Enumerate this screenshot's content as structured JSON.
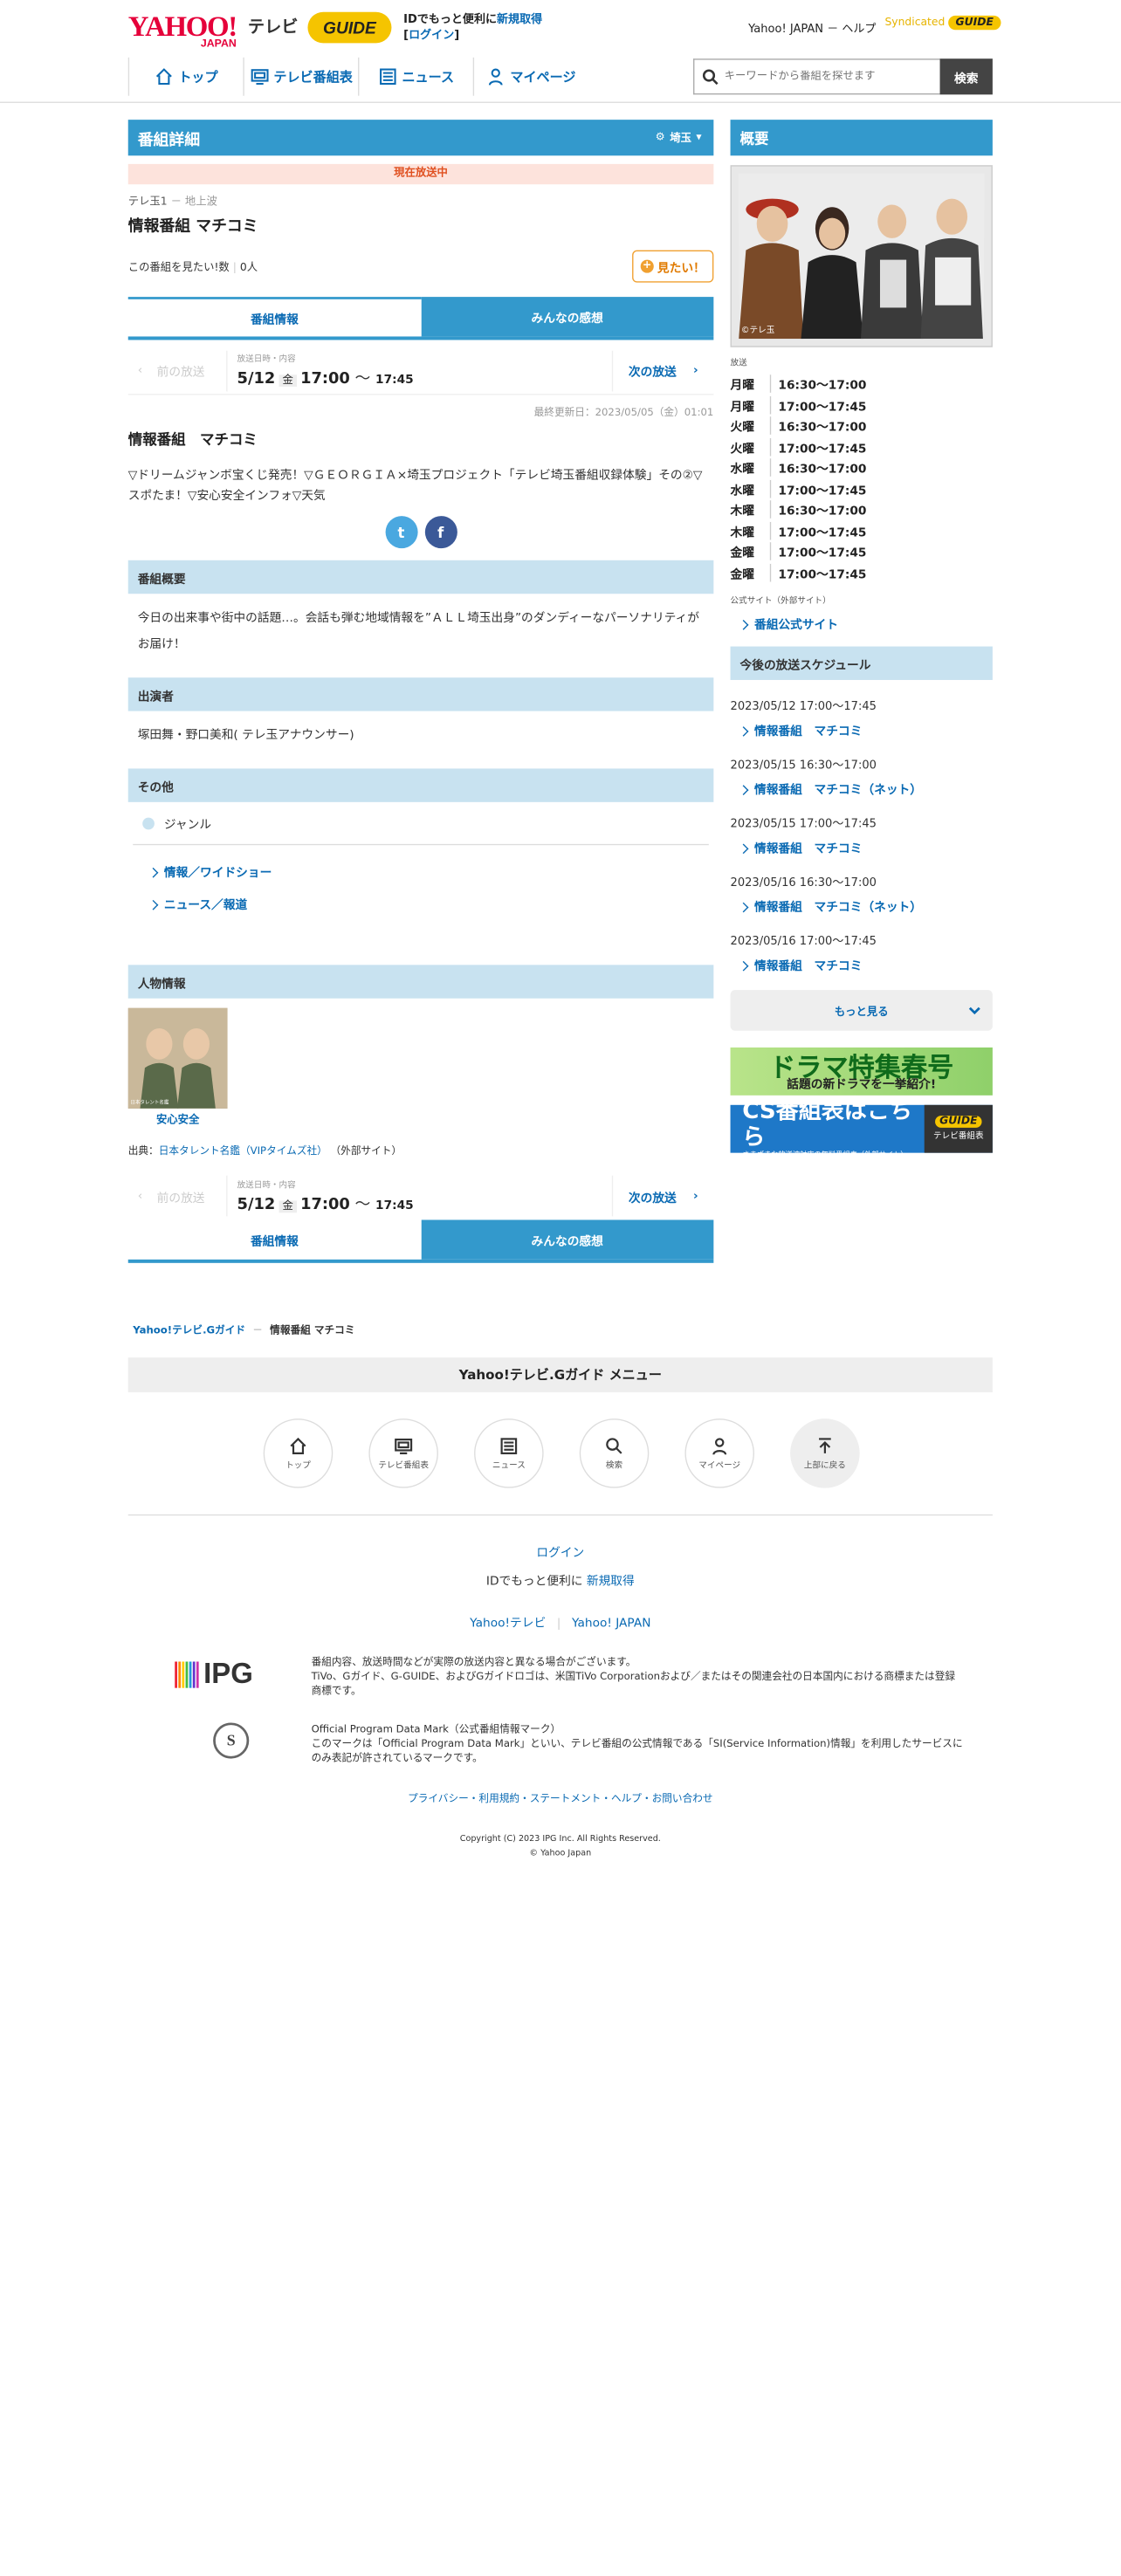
{
  "header": {
    "yahoo_logo": "YAHOO!",
    "yahoo_japan": "JAPAN",
    "tv_label": "テレビ",
    "gguide_logo": "GUIDE",
    "login_line1": "IDでもっと便利に",
    "signup": "新規取得",
    "login": "ログイン",
    "yahoo_japan_link": "Yahoo! JAPAN",
    "help": "ヘルプ",
    "syndicated": "Syndicated",
    "syndicated_badge": "GUIDE"
  },
  "nav": [
    {
      "label": "トップ",
      "icon": "home-icon"
    },
    {
      "label": "テレビ番組表",
      "icon": "tv-icon"
    },
    {
      "label": "ニュース",
      "icon": "news-icon"
    },
    {
      "label": "マイページ",
      "icon": "user-icon"
    }
  ],
  "search": {
    "placeholder": "キーワードから番組を探せます",
    "button": "検索"
  },
  "detail": {
    "bar_title": "番組詳細",
    "prefecture": "埼玉",
    "on_air": "現在放送中",
    "channel": "テレ玉1",
    "channel_type": "地上波",
    "title": "情報番組 マチコミ",
    "want_label": "この番組を見たい!数",
    "want_count": "0人",
    "want_button": "見たい！"
  },
  "tabs": {
    "info": "番組情報",
    "reviews": "みんなの感想"
  },
  "broadcast": {
    "prev": "前の放送",
    "label": "放送日時・内容",
    "date": "5/12",
    "weekday": "金",
    "start": "17:00",
    "sep": "〜",
    "end": "17:45",
    "next": "次の放送"
  },
  "updated": "最終更新日：2023/05/05（金）01:01",
  "program": {
    "title": "情報番組　マチコミ",
    "description": "▽ドリームジャンボ宝くじ発売！▽ＧＥＯＲＧＩＡ×埼玉プロジェクト「テレビ埼玉番組収録体験」その②▽スポたま！▽安心安全インフォ▽天気"
  },
  "sections": {
    "overview_title": "番組概要",
    "overview": "今日の出来事や街中の話題…。会話も弾む地域情報を”ＡＬＬ埼玉出身”のダンディーなパーソナリティがお届け！",
    "cast_title": "出演者",
    "cast": "塚田舞・野口美和( テレ玉アナウンサー)",
    "other_title": "その他",
    "genre_label": "ジャンル",
    "genres": [
      "情報／ワイドショー",
      "ニュース／報道"
    ],
    "people_title": "人物情報",
    "person_name": "安心安全",
    "person_credit": "日本タレント名鑑",
    "source_label": "出典：",
    "source_link": "日本タレント名鑑（VIPタイムズ社）",
    "source_note": "（外部サイト）"
  },
  "breadcrumb": {
    "home": "Yahoo!テレビ.Gガイド",
    "current": "情報番組 マチコミ"
  },
  "footer": {
    "menu_title": "Yahoo!テレビ.Gガイド メニュー",
    "icons": [
      "トップ",
      "テレビ番組表",
      "ニュース",
      "検索",
      "マイページ",
      "上部に戻る"
    ],
    "login": "ログイン",
    "id_text": "IDでもっと便利に",
    "signup": "新規取得",
    "yahoo_tv": "Yahoo!テレビ",
    "yahoo_japan": "Yahoo! JAPAN",
    "ipg": "IPG",
    "notice1": "番組内容、放送時間などが実際の放送内容と異なる場合がございます。",
    "notice2": "TiVo、Gガイド、G-GUIDE、およびGガイドロゴは、米国TiVo Corporationおよび／またはその関連会社の日本国内における商標または登録商標です。",
    "opdm_title": "Official Program Data Mark（公式番組情報マーク）",
    "opdm_text": "このマークは「Official Program Data Mark」といい、テレビ番組の公式情報である「SI(Service Information)情報」を利用したサービスにのみ表記が許されているマークです。",
    "seal": "S",
    "links": "プライバシー・利用規約・ステートメント・ヘルプ・お問い合わせ",
    "copyright": "Copyright (C) 2023 IPG Inc. All Rights Reserved.",
    "yahoo_copy": "© Yahoo Japan"
  },
  "side": {
    "overview_title": "概要",
    "image_credit": "©テレ玉",
    "broadcast_label": "放送",
    "schedule": [
      {
        "day": "月曜",
        "time": "16:30～17:00"
      },
      {
        "day": "月曜",
        "time": "17:00～17:45"
      },
      {
        "day": "火曜",
        "time": "16:30～17:00"
      },
      {
        "day": "火曜",
        "time": "17:00～17:45"
      },
      {
        "day": "水曜",
        "time": "16:30～17:00"
      },
      {
        "day": "水曜",
        "time": "17:00～17:45"
      },
      {
        "day": "木曜",
        "time": "16:30～17:00"
      },
      {
        "day": "木曜",
        "time": "17:00～17:45"
      },
      {
        "day": "金曜",
        "time": "17:00～17:45"
      },
      {
        "day": "金曜",
        "time": "17:00～17:45"
      }
    ],
    "official_label": "公式サイト（外部サイト）",
    "official_link": "番組公式サイト",
    "upcoming_title": "今後の放送スケジュール",
    "upcoming": [
      {
        "time": "2023/05/12 17:00～17:45",
        "title": "情報番組　マチコミ"
      },
      {
        "time": "2023/05/15 16:30～17:00",
        "title": "情報番組　マチコミ（ネット）"
      },
      {
        "time": "2023/05/15 17:00～17:45",
        "title": "情報番組　マチコミ"
      },
      {
        "time": "2023/05/16 16:30～17:00",
        "title": "情報番組　マチコミ（ネット）"
      },
      {
        "time": "2023/05/16 17:00～17:45",
        "title": "情報番組　マチコミ"
      }
    ],
    "more": "もっと見る",
    "ad1_title": "ドラマ特集春号",
    "ad1_sub": "話題の新ドラマを一挙紹介!",
    "ad2_title": "CS番組表はこちら",
    "ad2_sub": "さまざまな放送波対応の無料番組表（外部サイト）",
    "ad2_badge": "GUIDE",
    "ad2_label": "テレビ番組表"
  },
  "colors": {
    "accent": "#3399cc",
    "link": "#0a6ab3",
    "onair_bg": "#fde3dc",
    "section_bg": "#c8e2f0"
  }
}
